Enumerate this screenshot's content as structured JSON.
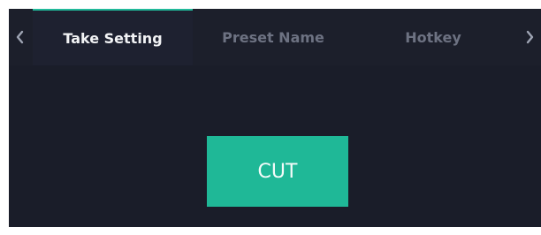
{
  "tabs": [
    {
      "label": "Take Setting",
      "active": true
    },
    {
      "label": "Preset Name",
      "active": false
    },
    {
      "label": "Hotkey",
      "active": false
    }
  ],
  "main": {
    "cut_label": "CUT"
  },
  "colors": {
    "accent": "#1fb897",
    "background": "#1a1d29",
    "active_tab_text": "#f2f3f5",
    "inactive_tab_text": "#6d7282"
  },
  "icons": {
    "left": "chevron-left-icon",
    "right": "chevron-right-icon"
  }
}
